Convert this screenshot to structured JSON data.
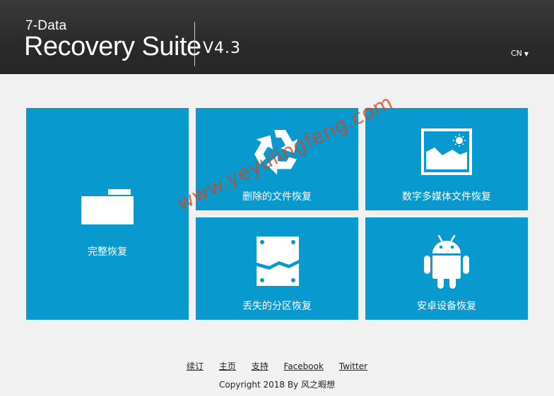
{
  "header": {
    "brand_top": "7-Data",
    "brand_main": "Recovery Suite",
    "version": "V4.3",
    "language": "CN"
  },
  "tiles": {
    "full_recovery": "完整恢复",
    "deleted_files": "删除的文件恢复",
    "digital_media": "数字多媒体文件恢复",
    "lost_partition": "丢失的分区恢复",
    "android": "安卓设备恢复"
  },
  "watermark": "www.yeyulingfeng.com",
  "footer": {
    "links": [
      "续订",
      "主页",
      "支持",
      "Facebook",
      "Twitter"
    ],
    "copyright": "Copyright 2018 By 风之暇想"
  },
  "colors": {
    "header_bg": "#2b2b2b",
    "tile_bg": "#0899cf",
    "page_bg": "#f1f1f1",
    "watermark": "#d2461a"
  },
  "icons": {
    "full_recovery": "folder-icon",
    "deleted_files": "recycle-icon",
    "digital_media": "image-icon",
    "lost_partition": "drive-icon",
    "android": "android-icon"
  }
}
